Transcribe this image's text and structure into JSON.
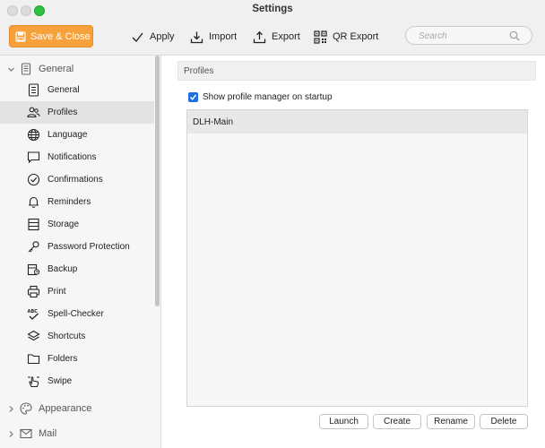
{
  "window": {
    "title": "Settings"
  },
  "toolbar": {
    "save_close": "Save & Close",
    "apply": "Apply",
    "import": "Import",
    "export": "Export",
    "qr_export": "QR Export",
    "search_placeholder": "Search"
  },
  "colors": {
    "accent": "#f7a13c",
    "checkbox": "#1f6fe5",
    "close_dot": "#dcdcdc",
    "zoom_dot": "#2dc140"
  },
  "sidebar": {
    "groups": [
      {
        "label": "General",
        "expanded": true
      },
      {
        "label": "Appearance",
        "expanded": false
      },
      {
        "label": "Mail",
        "expanded": false
      }
    ],
    "items": [
      {
        "label": "General",
        "icon": "document-list-icon"
      },
      {
        "label": "Profiles",
        "icon": "users-icon",
        "selected": true
      },
      {
        "label": "Language",
        "icon": "globe-icon"
      },
      {
        "label": "Notifications",
        "icon": "chat-bubble-icon"
      },
      {
        "label": "Confirmations",
        "icon": "check-circle-icon"
      },
      {
        "label": "Reminders",
        "icon": "bell-icon"
      },
      {
        "label": "Storage",
        "icon": "storage-icon"
      },
      {
        "label": "Password Protection",
        "icon": "key-icon"
      },
      {
        "label": "Backup",
        "icon": "backup-icon"
      },
      {
        "label": "Print",
        "icon": "printer-icon"
      },
      {
        "label": "Spell-Checker",
        "icon": "spell-check-icon"
      },
      {
        "label": "Shortcuts",
        "icon": "layers-icon"
      },
      {
        "label": "Folders",
        "icon": "folder-icon"
      },
      {
        "label": "Swipe",
        "icon": "hand-swipe-icon"
      }
    ]
  },
  "main": {
    "section_title": "Profiles",
    "show_manager_label": "Show profile manager on startup",
    "show_manager_checked": true,
    "profiles": [
      "DLH-Main"
    ],
    "buttons": {
      "launch": "Launch",
      "create": "Create",
      "rename": "Rename",
      "delete": "Delete"
    }
  }
}
